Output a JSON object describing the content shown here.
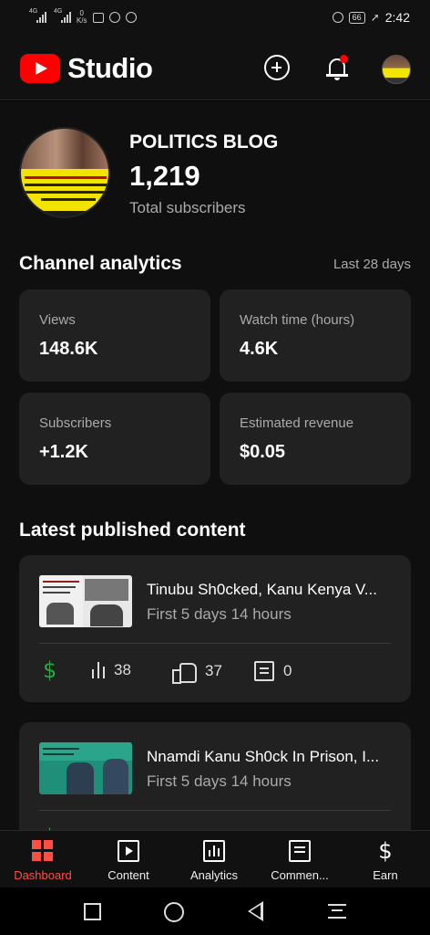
{
  "status_bar": {
    "sig1": "4G",
    "sig2": "4G",
    "net_speed_value": "0",
    "net_speed_unit": "K/s",
    "battery": "66",
    "time": "2:42"
  },
  "header": {
    "app_name": "Studio",
    "icons": [
      "create-plus-icon",
      "notifications-bell-icon",
      "account-avatar"
    ]
  },
  "channel": {
    "name": "POLITICS BLOG",
    "subscriber_count": "1,219",
    "subscriber_label": "Total subscribers"
  },
  "analytics": {
    "title": "Channel analytics",
    "period": "Last 28 days",
    "cards": [
      {
        "label": "Views",
        "value": "148.6K"
      },
      {
        "label": "Watch time (hours)",
        "value": "4.6K"
      },
      {
        "label": "Subscribers",
        "value": "+1.2K"
      },
      {
        "label": "Estimated revenue",
        "value": "$0.05"
      }
    ]
  },
  "latest": {
    "title": "Latest published content",
    "videos": [
      {
        "title": "Tinubu Sh0cked, Kanu Kenya V...",
        "meta": "First 5 days 14 hours",
        "revenue_icon": "$",
        "views": "38",
        "likes": "37",
        "comments": "0"
      },
      {
        "title": "Nnamdi Kanu Sh0ck In Prison, I...",
        "meta": "First 5 days 14 hours",
        "revenue_icon": "$"
      }
    ]
  },
  "bottom_nav": {
    "items": [
      {
        "label": "Dashboard",
        "active": true
      },
      {
        "label": "Content"
      },
      {
        "label": "Analytics"
      },
      {
        "label": "Commen..."
      },
      {
        "label": "Earn"
      }
    ],
    "earn_icon": "$"
  },
  "colors": {
    "accent_red": "#ff0000",
    "active_nav": "#ff4e45",
    "revenue_green": "#2ba640",
    "card_bg": "#212121",
    "page_bg": "#0f0f0f"
  }
}
